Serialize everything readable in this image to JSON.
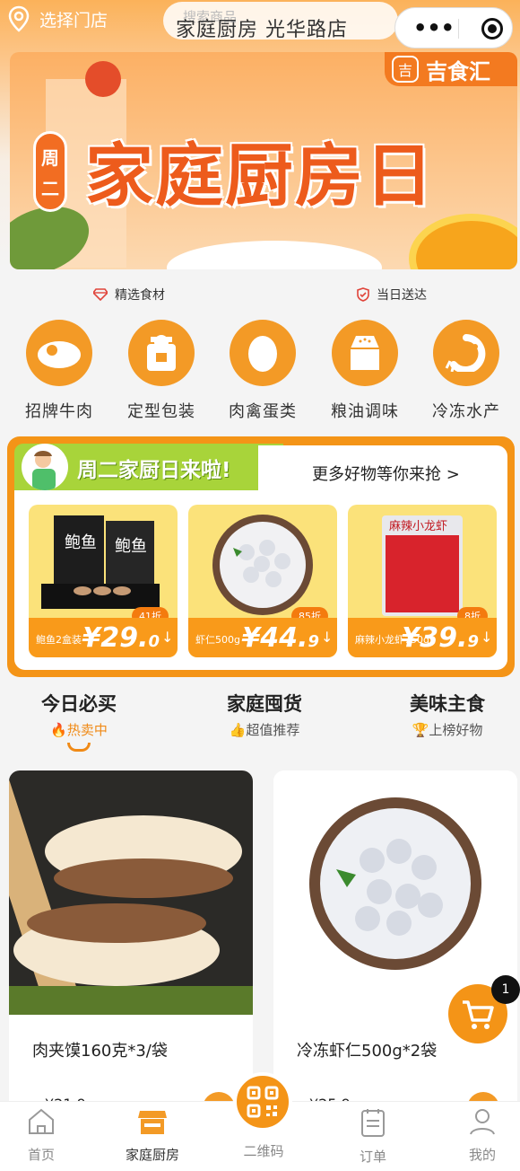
{
  "header": {
    "location_label": "选择门店",
    "search_placeholder": "搜索商品",
    "store_name": "家庭厨房 光华路店",
    "capsule_more": "•••"
  },
  "banner": {
    "brand_logo_char": "吉",
    "brand_name": "吉食汇",
    "weekday": "周二",
    "title": "家庭厨房日"
  },
  "features": [
    {
      "icon": "diamond-icon",
      "label": "精选食材"
    },
    {
      "icon": "shield-check-icon",
      "label": "当日送达"
    }
  ],
  "categories": [
    {
      "icon": "steak-icon",
      "label": "招牌牛肉"
    },
    {
      "icon": "package-icon",
      "label": "定型包装"
    },
    {
      "icon": "egg-icon",
      "label": "肉禽蛋类"
    },
    {
      "icon": "seasoning-icon",
      "label": "粮油调味"
    },
    {
      "icon": "shrimp-icon",
      "label": "冷冻水产"
    }
  ],
  "promo": {
    "title": "周二家厨日来啦!",
    "more_link": "更多好物等你来抢 >",
    "products": [
      {
        "name": "鲍鱼2盒装",
        "discount": "41折",
        "price_int": "¥29.",
        "price_dec": "0"
      },
      {
        "name": "虾仁500g",
        "discount": "85折",
        "price_int": "¥44.",
        "price_dec": "9"
      },
      {
        "name": "麻辣小龙虾750g",
        "discount": "8折",
        "price_int": "¥39.",
        "price_dec": "9"
      }
    ]
  },
  "tabs": [
    {
      "title": "今日必买",
      "sub": "热卖中",
      "active": true
    },
    {
      "title": "家庭囤货",
      "sub": "超值推荐",
      "active": false
    },
    {
      "title": "美味主食",
      "sub": "上榜好物",
      "active": false
    }
  ],
  "goods": [
    {
      "name": "肉夹馍160克*3/袋",
      "price": "¥21.9"
    },
    {
      "name": "冷冻虾仁500g*2袋",
      "price": "¥25.9"
    }
  ],
  "cart_badge": "1",
  "nav": [
    {
      "icon": "home-icon",
      "label": "首页"
    },
    {
      "icon": "store-icon",
      "label": "家庭厨房"
    },
    {
      "icon": "qr-code-icon",
      "label": "二维码"
    },
    {
      "icon": "orders-icon",
      "label": "订单"
    },
    {
      "icon": "profile-icon",
      "label": "我的"
    }
  ],
  "colors": {
    "accent": "#f39a26",
    "banner_title": "#ed5b1c",
    "promo_green": "#a8d43a"
  }
}
